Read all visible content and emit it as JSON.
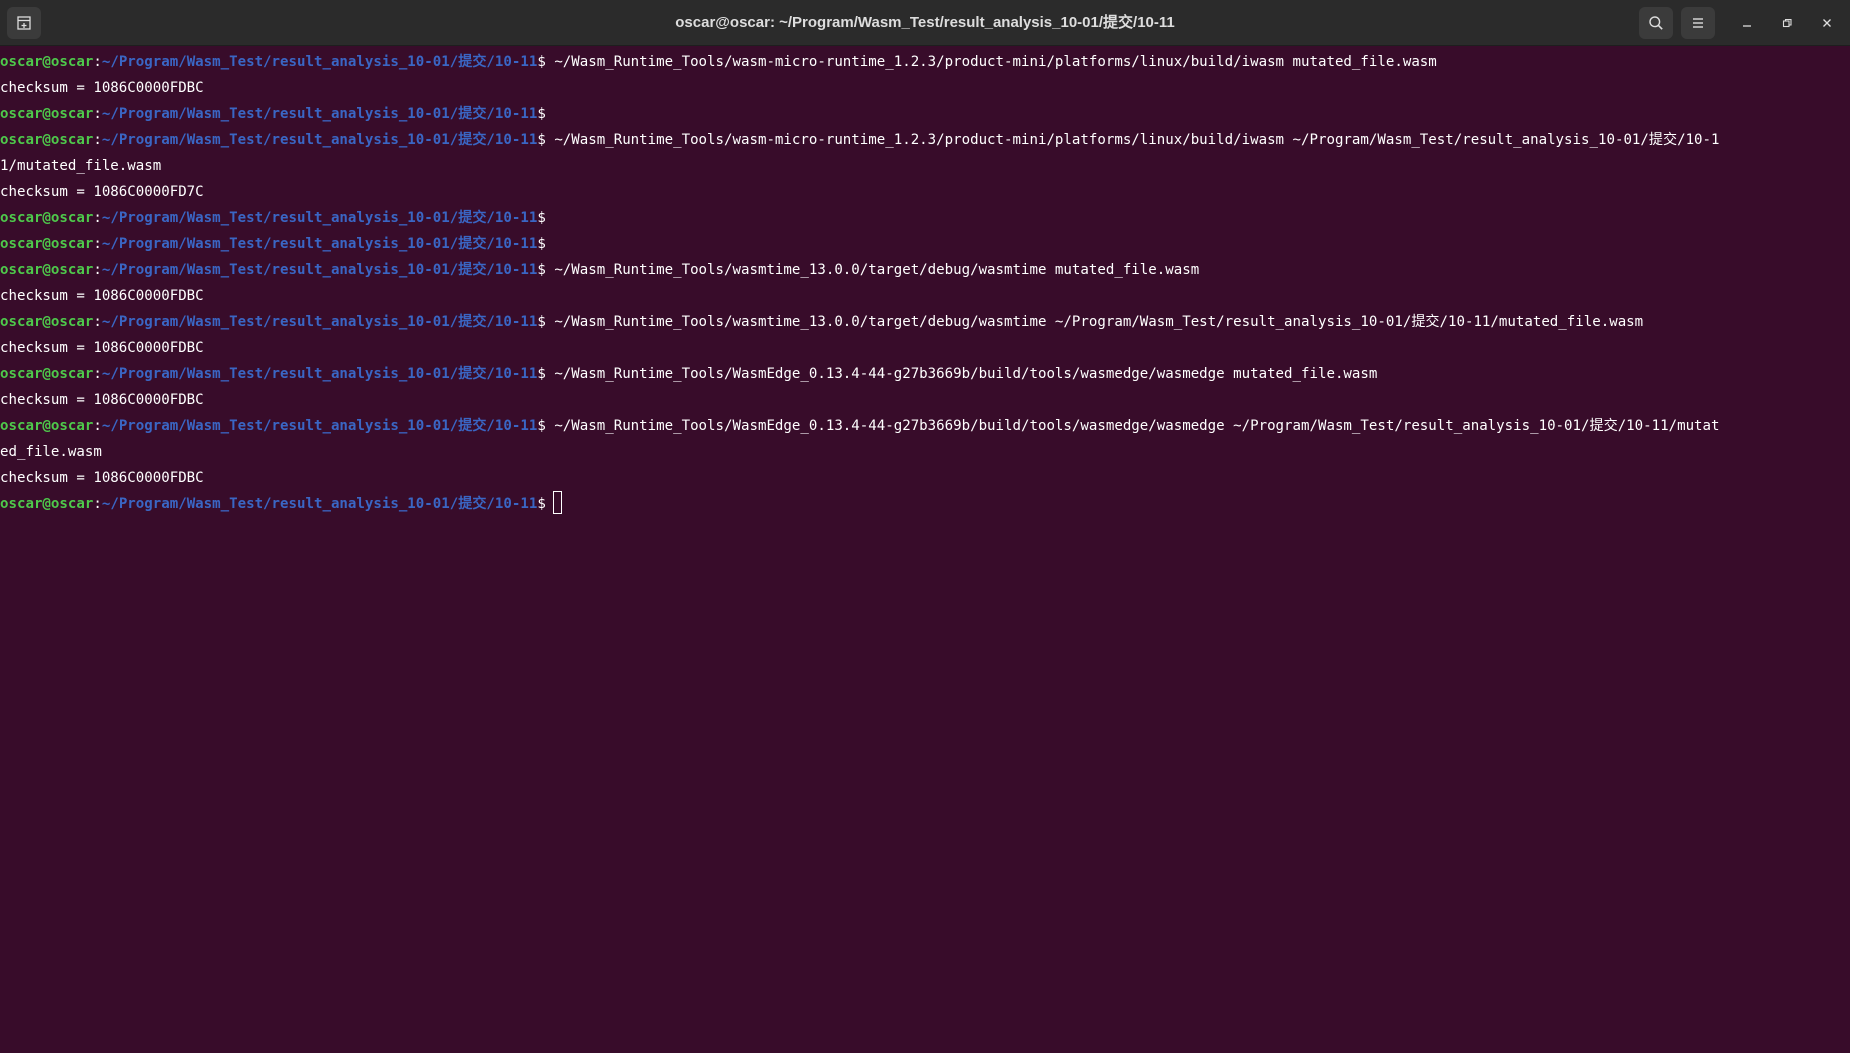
{
  "window": {
    "title": "oscar@oscar: ~/Program/Wasm_Test/result_analysis_10-01/提交/10-11"
  },
  "titlebar": {
    "new_tab_icon": "new-tab-icon",
    "search_icon": "search-icon",
    "menu_icon": "hamburger-menu-icon",
    "minimize_icon": "minimize-icon",
    "maximize_icon": "restore-icon",
    "close_icon": "close-icon"
  },
  "prompt": {
    "user": "oscar@oscar",
    "colon": ":",
    "path": "~/Program/Wasm_Test/result_analysis_10-01/提交/10-11",
    "dollar": "$"
  },
  "terminal": {
    "lines": [
      {
        "type": "prompt",
        "cmd": " ~/Wasm_Runtime_Tools/wasm-micro-runtime_1.2.3/product-mini/platforms/linux/build/iwasm mutated_file.wasm"
      },
      {
        "type": "output",
        "text": "checksum = 1086C0000FDBC"
      },
      {
        "type": "prompt",
        "cmd": ""
      },
      {
        "type": "prompt",
        "cmd": " ~/Wasm_Runtime_Tools/wasm-micro-runtime_1.2.3/product-mini/platforms/linux/build/iwasm ~/Program/Wasm_Test/result_analysis_10-01/提交/10-1"
      },
      {
        "type": "output",
        "text": "1/mutated_file.wasm"
      },
      {
        "type": "output",
        "text": "checksum = 1086C0000FD7C"
      },
      {
        "type": "prompt",
        "cmd": ""
      },
      {
        "type": "prompt",
        "cmd": ""
      },
      {
        "type": "prompt",
        "cmd": " ~/Wasm_Runtime_Tools/wasmtime_13.0.0/target/debug/wasmtime mutated_file.wasm"
      },
      {
        "type": "output",
        "text": "checksum = 1086C0000FDBC"
      },
      {
        "type": "prompt",
        "cmd": " ~/Wasm_Runtime_Tools/wasmtime_13.0.0/target/debug/wasmtime ~/Program/Wasm_Test/result_analysis_10-01/提交/10-11/mutated_file.wasm"
      },
      {
        "type": "output",
        "text": "checksum = 1086C0000FDBC"
      },
      {
        "type": "prompt",
        "cmd": " ~/Wasm_Runtime_Tools/WasmEdge_0.13.4-44-g27b3669b/build/tools/wasmedge/wasmedge mutated_file.wasm"
      },
      {
        "type": "output",
        "text": "checksum = 1086C0000FDBC"
      },
      {
        "type": "prompt",
        "cmd": " ~/Wasm_Runtime_Tools/WasmEdge_0.13.4-44-g27b3669b/build/tools/wasmedge/wasmedge ~/Program/Wasm_Test/result_analysis_10-01/提交/10-11/mutat"
      },
      {
        "type": "output",
        "text": "ed_file.wasm"
      },
      {
        "type": "output",
        "text": "checksum = 1086C0000FDBC"
      },
      {
        "type": "prompt",
        "cmd": "",
        "cursor": true
      }
    ]
  },
  "colors": {
    "background": "#380c2a",
    "titlebar": "#2b2b2b",
    "prompt_user": "#4ec94b",
    "prompt_path": "#3a66c4",
    "text": "#ffffff"
  }
}
